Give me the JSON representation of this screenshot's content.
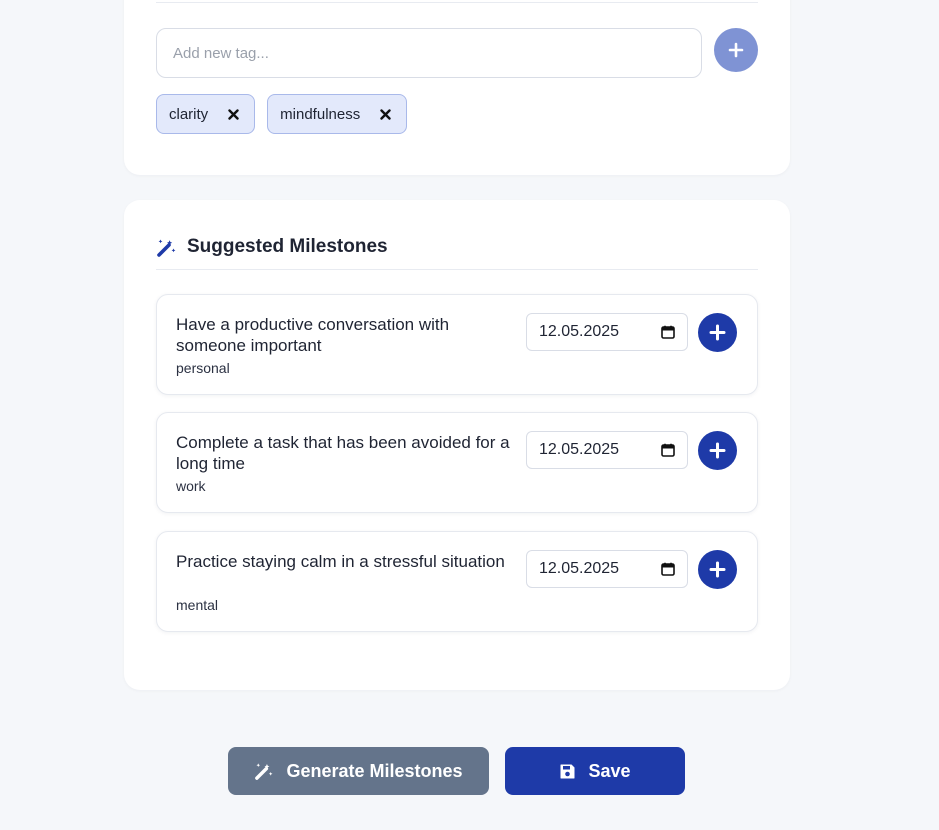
{
  "tags": {
    "input_value": "",
    "input_placeholder": "Add new tag...",
    "add_icon": "plus-icon",
    "items": [
      {
        "label": "clarity"
      },
      {
        "label": "mindfulness"
      }
    ]
  },
  "milestones": {
    "heading": "Suggested Milestones",
    "heading_icon": "magic-wand-icon",
    "items": [
      {
        "title": "Have a productive conversation with someone important",
        "category": "personal",
        "date": "12.05.2025"
      },
      {
        "title": "Complete a task that has been avoided for a long time",
        "category": "work",
        "date": "12.05.2025"
      },
      {
        "title": "Practice staying calm in a stressful situation",
        "category": "mental",
        "date": "12.05.2025"
      }
    ]
  },
  "actions": {
    "generate_label": "Generate Milestones",
    "generate_icon": "magic-wand-icon",
    "save_label": "Save",
    "save_icon": "floppy-disk-icon"
  },
  "colors": {
    "primary": "#1e3aa8",
    "primary_light": "#7f93d4",
    "secondary": "#64748b",
    "chip_bg": "#e3e9fb",
    "background": "#f5f7fa"
  }
}
